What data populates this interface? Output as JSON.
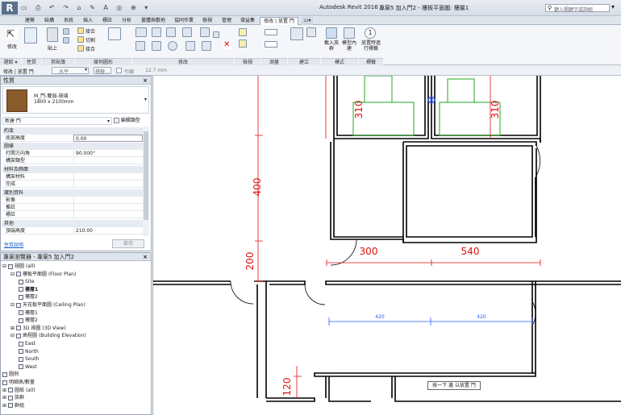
{
  "app": {
    "title": "Autodesk Revit 2016 -",
    "doc_title": "專案5 加入門2 - 樓板平面圖: 樓層1",
    "search_placeholder": "鍵入關鍵字或詞組"
  },
  "tabs": [
    "建築",
    "結構",
    "系統",
    "插入",
    "標註",
    "分析",
    "量體與敷地",
    "協同作業",
    "檢視",
    "管理",
    "增益集",
    "修改 | 放置 門"
  ],
  "ribbon": {
    "modify_label": "修改",
    "select_group": "選取 ▾",
    "properties_group": "性質",
    "clipboard_group": "剪貼簿",
    "geometry_group": "幾何圖形",
    "modify_group": "修改",
    "view_group": "檢視",
    "measure_group": "測量",
    "create_group": "建立",
    "mode_group": "模式",
    "tag_group": "標籤",
    "paste_label": "貼上",
    "cope_label": "接合",
    "cut_label": "切割",
    "join_label": "接合",
    "load_family_label": "載入族群",
    "model_inplace_label": "模型內建",
    "tag_on_place_label": "放置時進行標籤"
  },
  "options_bar": {
    "context": "修改 | 放置 門",
    "orientation": "水平",
    "tag_label": "標籤...",
    "leader_label": "引線",
    "leader_value": "12.7 mm"
  },
  "properties": {
    "header": "性質",
    "family_name": "M_門-雙扇-玻璃",
    "family_size": "1800 x 2100mm",
    "instance_selector": "新建 門",
    "edit_type_label": "編輯類型",
    "categories": [
      {
        "name": "約束",
        "rows": [
          {
            "key": "底部高度",
            "value": "0.00"
          }
        ]
      },
      {
        "name": "圖樣",
        "rows": [
          {
            "key": "打開方向角",
            "value": "90.000°"
          },
          {
            "key": "構架類型",
            "value": ""
          }
        ]
      },
      {
        "name": "材料及飾面",
        "rows": [
          {
            "key": "構架材料",
            "value": ""
          },
          {
            "key": "完成",
            "value": ""
          }
        ]
      },
      {
        "name": "識別資料",
        "rows": [
          {
            "key": "影像",
            "value": ""
          },
          {
            "key": "備註",
            "value": ""
          },
          {
            "key": "標註",
            "value": ""
          }
        ]
      },
      {
        "name": "其他",
        "rows": [
          {
            "key": "頂端高度",
            "value": "210.00"
          }
        ]
      }
    ],
    "help_link": "性質說明",
    "apply_label": "套用"
  },
  "project_browser": {
    "header": "專案瀏覽器 - 專案5 加入門2",
    "nodes": [
      {
        "label": "視圖 (all)",
        "level": 0,
        "expander": "⊟"
      },
      {
        "label": "樓板平面圖 (Floor Plan)",
        "level": 1,
        "expander": "⊟"
      },
      {
        "label": "Site",
        "level": 2,
        "expander": ""
      },
      {
        "label": "樓層1",
        "level": 2,
        "expander": "",
        "bold": true
      },
      {
        "label": "樓層2",
        "level": 2,
        "expander": ""
      },
      {
        "label": "天花板平面圖 (Ceiling Plan)",
        "level": 1,
        "expander": "⊟"
      },
      {
        "label": "樓層1",
        "level": 2,
        "expander": ""
      },
      {
        "label": "樓層2",
        "level": 2,
        "expander": ""
      },
      {
        "label": "3D 視圖 (3D View)",
        "level": 1,
        "expander": "⊞"
      },
      {
        "label": "高程圖 (Building Elevation)",
        "level": 1,
        "expander": "⊟"
      },
      {
        "label": "East",
        "level": 2,
        "expander": ""
      },
      {
        "label": "North",
        "level": 2,
        "expander": ""
      },
      {
        "label": "South",
        "level": 2,
        "expander": ""
      },
      {
        "label": "West",
        "level": 2,
        "expander": ""
      },
      {
        "label": "圖例",
        "level": 0,
        "expander": ""
      },
      {
        "label": "明細表/數量",
        "level": 0,
        "expander": ""
      },
      {
        "label": "圖紙 (all)",
        "level": 0,
        "expander": "⊞"
      },
      {
        "label": "族群",
        "level": 0,
        "expander": "⊞"
      },
      {
        "label": "群組",
        "level": 0,
        "expander": "⊞"
      }
    ]
  },
  "drawing": {
    "dims": {
      "d310a": "310",
      "d310b": "310",
      "d400": "400",
      "d200": "200",
      "d300": "300",
      "d540": "540",
      "d420a": "420",
      "d420b": "420",
      "d120": "120"
    },
    "tooltip": "按一下 邊 以放置 門"
  },
  "colors": {
    "dimension": "#e01010",
    "temp_dimension": "#2a5cff",
    "wall": "#000000",
    "room": "#22aa22"
  }
}
